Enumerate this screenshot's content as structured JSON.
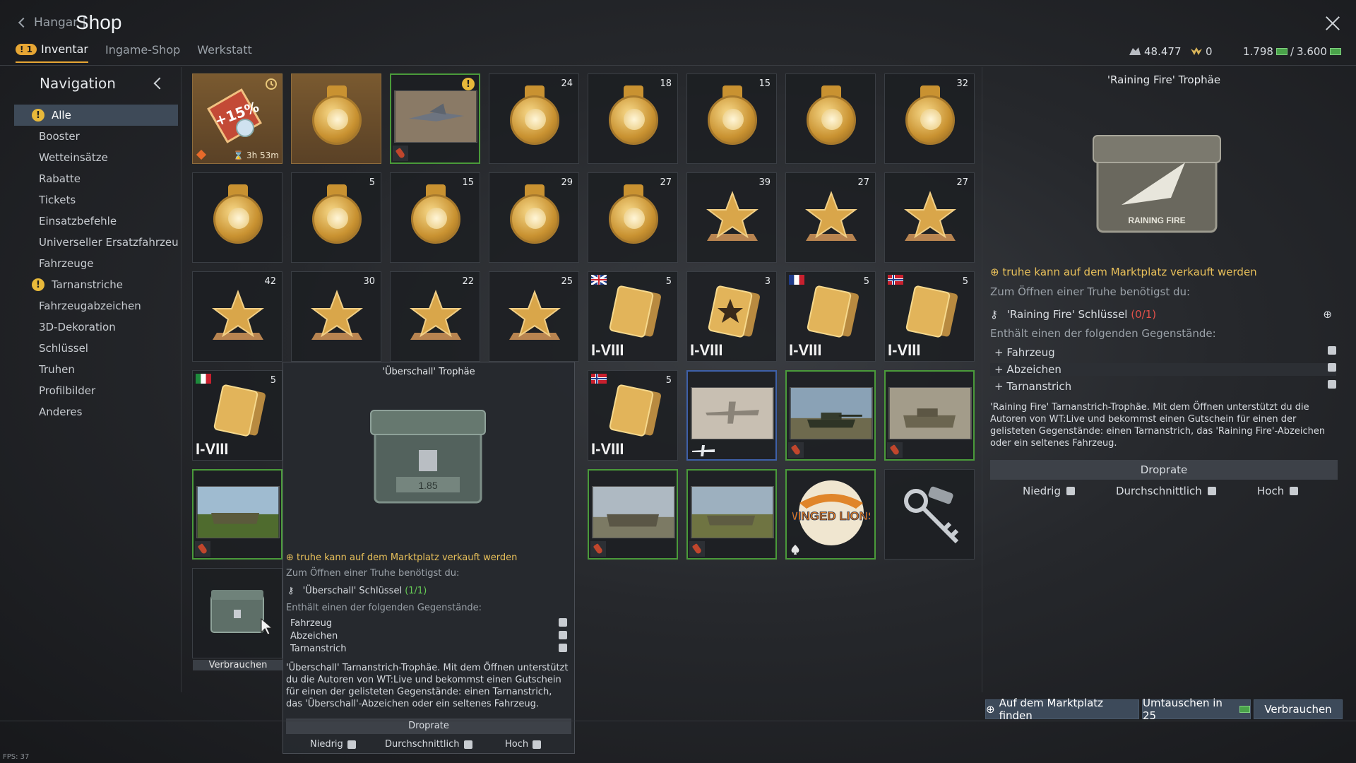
{
  "header": {
    "back_label": "Hangar",
    "separator": "|",
    "title": "Shop",
    "tabs": [
      {
        "label": "Inventar",
        "badge": "1",
        "active": true
      },
      {
        "label": "Ingame-Shop",
        "active": false
      },
      {
        "label": "Werkstatt",
        "active": false
      }
    ],
    "currency": {
      "silver": "48.477",
      "eagles": "0",
      "warbonds": "1.798",
      "warbonds_sep": "/",
      "warbonds_max": "3.600"
    }
  },
  "sidebar": {
    "title": "Navigation",
    "items": [
      {
        "label": "Alle",
        "active": true,
        "warn": true
      },
      {
        "label": "Booster"
      },
      {
        "label": "Wetteinsätze"
      },
      {
        "label": "Rabatte"
      },
      {
        "label": "Tickets"
      },
      {
        "label": "Einsatzbefehle"
      },
      {
        "label": "Universeller Ersatzfahrzeug-G"
      },
      {
        "label": "Fahrzeuge"
      },
      {
        "label": "Tarnanstriche",
        "warn": true
      },
      {
        "label": "Fahrzeugabzeichen"
      },
      {
        "label": "3D-Dekoration"
      },
      {
        "label": "Schlüssel"
      },
      {
        "label": "Truhen"
      },
      {
        "label": "Profilbilder"
      },
      {
        "label": "Anderes"
      }
    ]
  },
  "warn_symbol": "!",
  "grid": {
    "booster": {
      "percent": "+15%",
      "timer": "3h 53m"
    },
    "counts": {
      "r1c4": "24",
      "r1c5": "18",
      "r1c6": "15",
      "r1c8": "32",
      "r2c2": "5",
      "r2c3": "15",
      "r2c4": "29",
      "r2c5": "27",
      "r2c6": "39",
      "r2c7": "27",
      "r2c8": "27",
      "r3c1": "42",
      "r3c2": "30",
      "r3c3": "22",
      "r3c4": "25",
      "r3c5": "5",
      "r3c6": "3",
      "r3c7": "5",
      "r3c8": "5",
      "r4c1": "5",
      "r4c5": "5"
    },
    "tier_label": "I-VIII",
    "consume_label": "Verbrauchen",
    "winged_lions_text": "WINGED LIONS"
  },
  "tooltip": {
    "title": "'Überschall' Trophäe",
    "market_line": "truhe kann auf dem Marktplatz verkauft werden",
    "need_line": "Zum Öffnen einer Truhe benötigst du:",
    "key_label": "'Überschall' Schlüssel",
    "key_count": "(1/1)",
    "contains_line": "Enthält einen der folgenden Gegenstände:",
    "contents": [
      "Fahrzeug",
      "Abzeichen",
      "Tarnanstrich"
    ],
    "description": "'Überschall' Tarnanstrich-Trophäe. Mit dem Öffnen unterstützt du die Autoren von WT:Live und bekommst einen Gutschein für einen der gelisteten Gegenstände: einen Tarnanstrich, das 'Überschall'-Abzeichen oder ein seltenes Fahrzeug.",
    "droprate_label": "Droprate",
    "rates": [
      "Niedrig",
      "Durchschnittlich",
      "Hoch"
    ],
    "chest_stamp": "1.85"
  },
  "right_panel": {
    "title": "'Raining Fire' Trophäe",
    "chest_text": "RAINING FIRE",
    "market_line": "truhe kann auf dem Marktplatz verkauft werden",
    "need_line": "Zum Öffnen einer Truhe benötigst du:",
    "key_label": "'Raining Fire' Schlüssel",
    "key_count": "(0/1)",
    "contains_line": "Enthält einen der folgenden Gegenstände:",
    "contents": [
      "Fahrzeug",
      "Abzeichen",
      "Tarnanstrich"
    ],
    "description": "'Raining Fire' Tarnanstrich-Trophäe. Mit dem Öffnen unterstützt du die Autoren von WT:Live und bekommst einen Gutschein für einen der gelisteten Gegenstände: einen Tarnanstrich, das 'Raining Fire'-Abzeichen oder ein seltenes Fahrzeug.",
    "droprate_label": "Droprate",
    "rates": [
      "Niedrig",
      "Durchschnittlich",
      "Hoch"
    ]
  },
  "actions": {
    "market_button": "Auf dem Marktplatz finden",
    "exchange_button": "Umtauschen in 25",
    "consume_button": "Verbrauchen"
  },
  "fps": "FPS: 37",
  "colors": {
    "accent": "#e7a634",
    "selected_green": "#4a9a3a",
    "button_bg": "#3d4a5a"
  }
}
